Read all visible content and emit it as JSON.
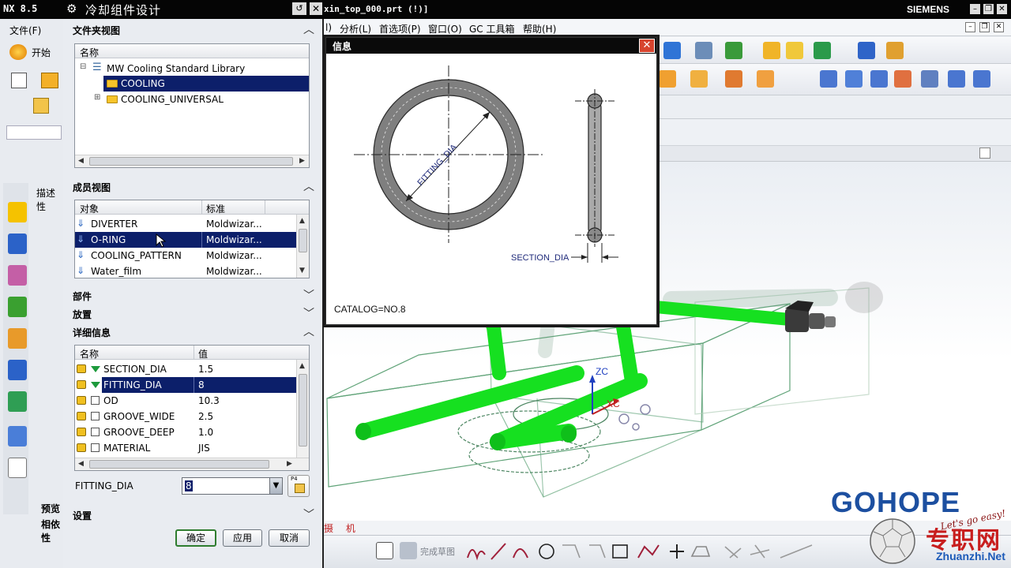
{
  "window": {
    "app_version": "NX 8.5",
    "file_title": "xin_top_000.prt    (!)]",
    "brand": "SIEMENS"
  },
  "menubar": {
    "items": [
      "l)",
      "分析(L)",
      "首选项(P)",
      "窗口(O)",
      "GC 工具箱",
      "帮助(H)"
    ]
  },
  "left_menu": {
    "file": "文件(F)",
    "start": "开始"
  },
  "dialog": {
    "title": "冷却组件设计",
    "folder_view": {
      "header": "文件夹视图",
      "col_name": "名称",
      "items": [
        "MW Cooling Standard Library",
        "COOLING",
        "COOLING_UNIVERSAL"
      ]
    },
    "member_view": {
      "header": "成员视图",
      "col_object": "对象",
      "col_standard": "标准",
      "rows": [
        {
          "name": "DIVERTER",
          "std": "Moldwizar..."
        },
        {
          "name": "O-RING",
          "std": "Moldwizar..."
        },
        {
          "name": "COOLING_PATTERN",
          "std": "Moldwizar..."
        },
        {
          "name": "Water_film",
          "std": "Moldwizar..."
        }
      ]
    },
    "parts_header": "部件",
    "placement_header": "放置",
    "details": {
      "header": "详细信息",
      "col_name": "名称",
      "col_value": "值",
      "rows": [
        {
          "name": "SECTION_DIA",
          "value": "1.5"
        },
        {
          "name": "FITTING_DIA",
          "value": "8"
        },
        {
          "name": "OD",
          "value": "10.3"
        },
        {
          "name": "GROOVE_WIDE",
          "value": "2.5"
        },
        {
          "name": "GROOVE_DEEP",
          "value": "1.0"
        },
        {
          "name": "MATERIAL",
          "value": "JIS"
        }
      ]
    },
    "param_label": "FITTING_DIA",
    "param_value": "8",
    "settings_header": "设置",
    "ok": "确定",
    "apply": "应用",
    "cancel": "取消"
  },
  "side_panel": {
    "desc_tab": "描述性",
    "preview": "预览",
    "dependency": "相依性"
  },
  "info_window": {
    "title": "信息",
    "fitting_label": "FITTING_DIA",
    "section_label": "SECTION_DIA",
    "catalog": "CATALOG=NO.8"
  },
  "viewport": {
    "axis_zc": "ZC",
    "axis_xc": "XC",
    "status_text": "摄 机"
  },
  "bottom_toolbar": {
    "finish_sketch": "完成草图"
  },
  "watermark": {
    "brand": "GOHOPE",
    "slogan": "Let's go easy!",
    "site_cn": "专职网",
    "site": "Zhuanzhi.Net"
  }
}
